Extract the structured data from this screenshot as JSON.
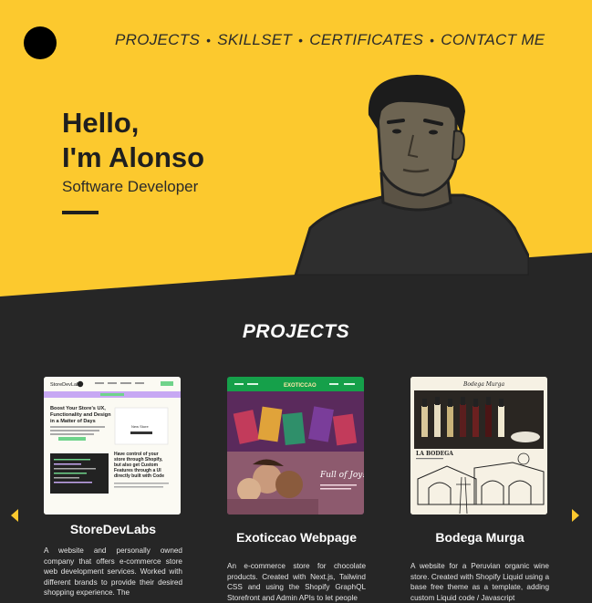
{
  "nav": {
    "items": [
      "PROJECTS",
      "SKILLSET",
      "CERTIFICATES",
      "CONTACT ME"
    ],
    "separator": "•"
  },
  "hero": {
    "greeting_line1": "Hello,",
    "greeting_line2": "I'm Alonso",
    "role": "Software Developer"
  },
  "projects": {
    "title": "PROJECTS",
    "items": [
      {
        "title": "StoreDevLabs",
        "description": "A website and personally owned company that offers e-commerce store web development services. Worked with different brands to provide their desired shopping experience. The",
        "thumb": {
          "brand": "StoreDevLabs",
          "headline": "Boost Your Store's UX, Functionality and Design in a Matter of Days",
          "cta": "Let's Start",
          "headline2": "Have control of your store through Shopify, but also get Custom Features through a UI directly built with Code"
        }
      },
      {
        "title": "Exoticcao Webpage",
        "description": "An e-commerce store for chocolate products. Created with Next.js, Tailwind CSS and using the Shopify GraphQL Storefront and Admin APIs to let people",
        "thumb": {
          "brand": "EXOTICCAO",
          "tagline": "Full of Joy!"
        }
      },
      {
        "title": "Bodega Murga",
        "description": "A website for a Peruvian organic wine store. Created with Shopify Liquid using a base free theme as a template, adding custom Liquid code / Javascript",
        "thumb": {
          "brand": "Bodega Murga",
          "sign": "LA BODEGA"
        }
      }
    ]
  },
  "colors": {
    "accent": "#fcc92e",
    "dark": "#262626",
    "text_light": "#ffffff"
  },
  "icons": {
    "prev": "chevron-left-icon",
    "next": "chevron-right-icon",
    "logo": "circle-logo"
  }
}
